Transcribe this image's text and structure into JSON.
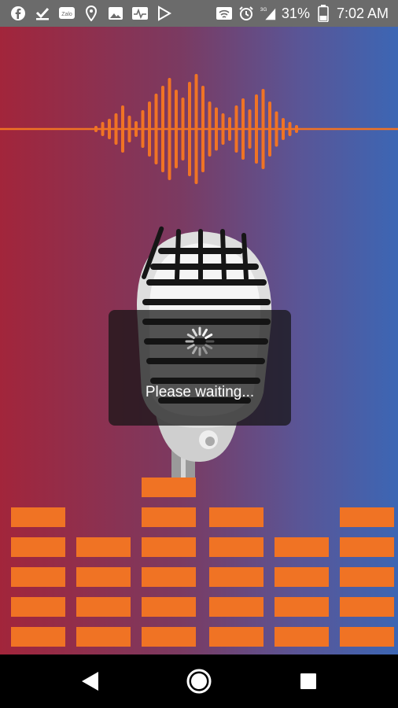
{
  "status_bar": {
    "left_icons": [
      "facebook-icon",
      "download-done-icon",
      "zalo-icon",
      "location-icon",
      "image-icon",
      "activity-icon",
      "play-store-icon"
    ],
    "battery_percent": "31%",
    "time": "7:02 AM",
    "network": "3G"
  },
  "colors": {
    "accent": "#f07324",
    "bg_left": "#a2253b",
    "bg_right": "#3c66b4"
  },
  "dialog": {
    "message": "Please waiting..."
  },
  "equalizer": {
    "column_levels": [
      5,
      4,
      6,
      5,
      4,
      5
    ]
  },
  "nav_bar": {
    "buttons": [
      "back",
      "home",
      "recents"
    ]
  }
}
